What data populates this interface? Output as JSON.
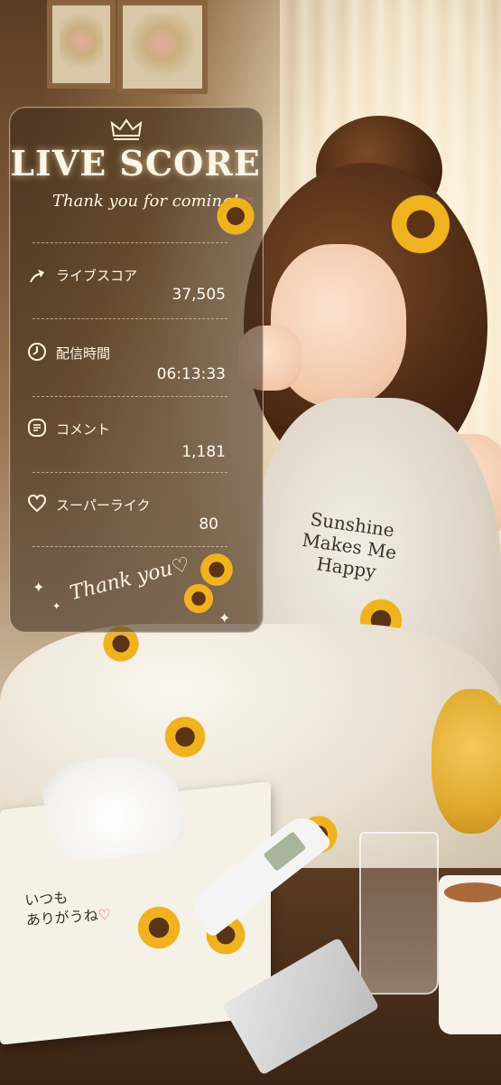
{
  "score_card": {
    "title": "LIVE SCORE",
    "subtitle": "Thank you for coming!",
    "stats": [
      {
        "icon": "arrow-up-icon",
        "label": "ライブスコア",
        "value": "37,505"
      },
      {
        "icon": "clock-icon",
        "label": "配信時間",
        "value": "06:13:33"
      },
      {
        "icon": "comment-icon",
        "label": "コメント",
        "value": "1,181"
      },
      {
        "icon": "heart-icon",
        "label": "スーパーライク",
        "value": "80"
      }
    ],
    "footer": "Thank you"
  },
  "scene": {
    "shirt_text": [
      "Sunshine",
      "Makes Me",
      "Happy"
    ],
    "tissue_box_text": [
      "いつも",
      "ありがうね"
    ]
  },
  "colors": {
    "panel_bg": "#3a281a",
    "text_light": "#fff6e6",
    "accent_heart": "#f08aa0",
    "sunflower": "#f1b21f"
  }
}
